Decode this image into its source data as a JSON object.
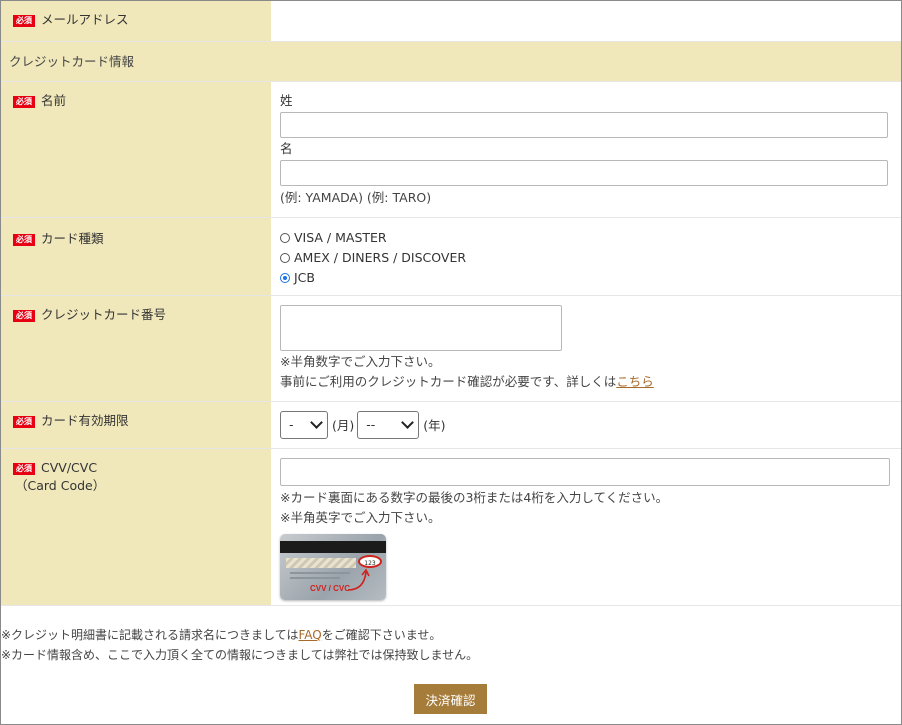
{
  "required_badge": "必須",
  "email": {
    "label": "メールアドレス"
  },
  "credit_section": {
    "title": "クレジットカード情報"
  },
  "name": {
    "label": "名前",
    "last_label": "姓",
    "first_label": "名",
    "example": "(例: YAMADA) (例: TARO)"
  },
  "card_type": {
    "label": "カード種類",
    "options": [
      {
        "label": "VISA / MASTER",
        "checked": false
      },
      {
        "label": "AMEX / DINERS / DISCOVER",
        "checked": false
      },
      {
        "label": "JCB",
        "checked": true
      }
    ]
  },
  "card_number": {
    "label": "クレジットカード番号",
    "note1": "※半角数字でご入力下さい。",
    "note2_prefix": "事前にご利用のクレジットカード確認が必要です、詳しくは",
    "note2_link": "こちら"
  },
  "expiry": {
    "label": "カード有効期限",
    "month_value": "-",
    "month_unit": "(月)",
    "year_value": "--",
    "year_unit": "(年)"
  },
  "cvv": {
    "label_line1": "CVV/CVC",
    "label_line2": "（Card Code）",
    "note1": "※カード裏面にある数字の最後の3桁または4桁を入力してください。",
    "note2": "※半角英字でご入力下さい。",
    "image_caption": "CVV / CVC",
    "image_number": "123"
  },
  "footer": {
    "line1_prefix": "※クレジット明細書に記載される請求名につきましては",
    "line1_link": "FAQ",
    "line1_suffix": "をご確認下さいませ。",
    "line2": "※カード情報含め、ここで入力頂く全ての情報につきましては弊社では保持致しません。"
  },
  "submit": {
    "label": "決済確認"
  },
  "colors": {
    "label_bg": "#f0e8bb",
    "badge": "#e60012",
    "button": "#a67c3a",
    "link": "#a86a2b",
    "radio_checked": "#1a73e8"
  }
}
